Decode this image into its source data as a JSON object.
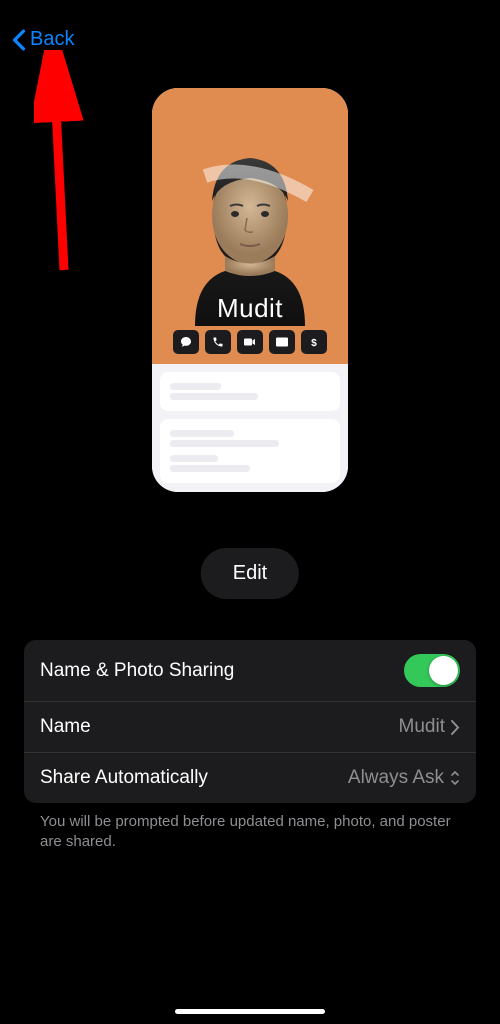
{
  "nav": {
    "back_label": "Back"
  },
  "contact": {
    "display_name": "Mudit",
    "actions": [
      "message",
      "phone",
      "video",
      "mail",
      "pay"
    ]
  },
  "edit_btn": {
    "label": "Edit"
  },
  "settings": {
    "sharing_label": "Name & Photo Sharing",
    "sharing_on": true,
    "name_label": "Name",
    "name_value": "Mudit",
    "auto_label": "Share Automatically",
    "auto_value": "Always Ask"
  },
  "footnote": "You will be prompted before updated name, photo, and poster are shared."
}
